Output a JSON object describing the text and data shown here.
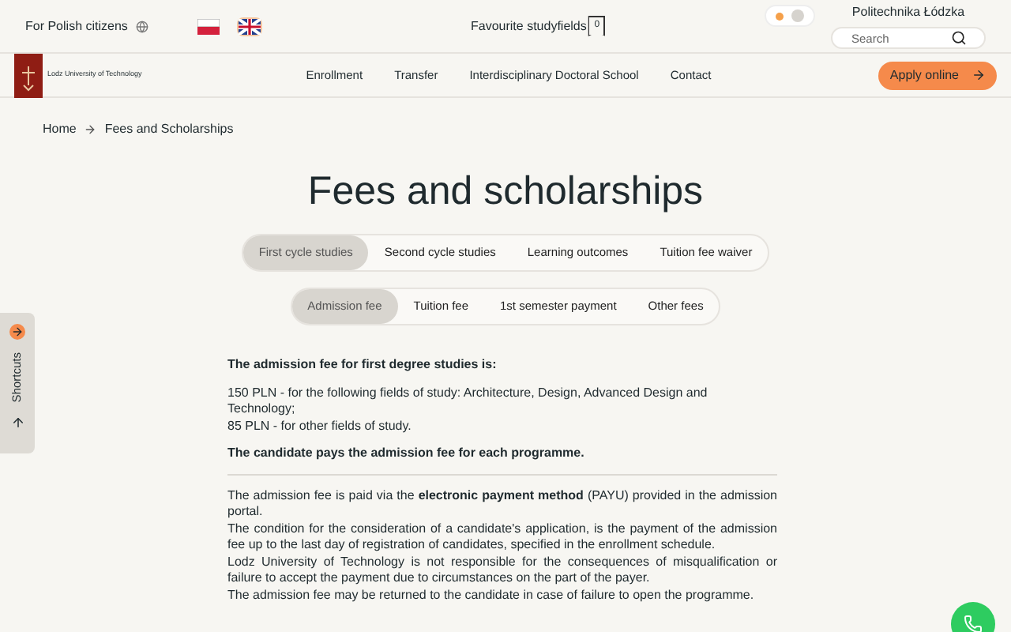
{
  "top_bar": {
    "citizens_link": "For Polish citizens",
    "languages": [
      {
        "kind": "pl",
        "selected": false
      },
      {
        "kind": "en",
        "selected": true
      }
    ],
    "favourites": {
      "label": "Favourite studyfields",
      "count": "0"
    },
    "theme_toggle": [
      {
        "color": "#f5a04a",
        "selected": true
      },
      {
        "color": "#d6d3ce",
        "selected": false
      }
    ],
    "university_name": "Politechnika Łódzka",
    "search": {
      "placeholder": "Search"
    }
  },
  "nav": {
    "logo_text": "Lodz University of Technology",
    "items": [
      "Enrollment",
      "Transfer",
      "Interdisciplinary Doctoral School",
      "Contact"
    ],
    "apply_button": "Apply online"
  },
  "breadcrumb": [
    "Home",
    "Fees and Scholarships"
  ],
  "title": "Fees and scholarships",
  "study_tabs": [
    {
      "label": "First cycle studies",
      "selected": true
    },
    {
      "label": "Second cycle studies",
      "selected": false
    },
    {
      "label": "Learning outcomes",
      "selected": false
    },
    {
      "label": "Tuition fee waiver",
      "selected": false
    }
  ],
  "fee_tabs": [
    {
      "label": "Admission fee",
      "selected": true
    },
    {
      "label": "Tuition fee",
      "selected": false
    },
    {
      "label": "1st semester payment",
      "selected": false
    },
    {
      "label": "Other fees",
      "selected": false
    }
  ],
  "shortcuts": {
    "label": "Shortcuts"
  },
  "content": {
    "heading": "The admission fee for first degree studies is:",
    "fees": [
      "150 PLN - for the following fields of study: Architecture, Design, Advanced Design and Technology;",
      "85 PLN - for other fields of study."
    ],
    "note": "The candidate pays the admission fee for each programme.",
    "details": [
      "The admission fee is paid via the **electronic payment method** (PAYU) provided in the admission portal.",
      "The condition for the consideration of a candidate's application, is the payment of the admission fee up to the last day of registration of candidates, specified in the enrollment schedule.",
      "Lodz University of Technology is not responsible for the consequences of misqualification or failure to accept the payment due to circumstances on the part of the payer.",
      "The admission fee may be returned to the candidate in case of failure to open the programme."
    ]
  }
}
